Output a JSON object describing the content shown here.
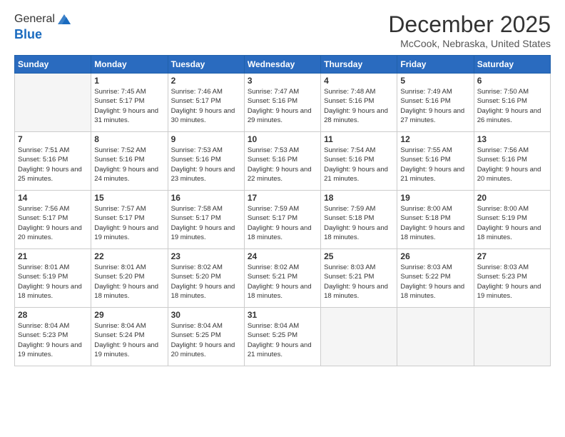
{
  "logo": {
    "general": "General",
    "blue": "Blue"
  },
  "header": {
    "month": "December 2025",
    "location": "McCook, Nebraska, United States"
  },
  "weekdays": [
    "Sunday",
    "Monday",
    "Tuesday",
    "Wednesday",
    "Thursday",
    "Friday",
    "Saturday"
  ],
  "weeks": [
    [
      {
        "day": "",
        "empty": true
      },
      {
        "day": "1",
        "sunrise": "Sunrise: 7:45 AM",
        "sunset": "Sunset: 5:17 PM",
        "daylight": "Daylight: 9 hours and 31 minutes."
      },
      {
        "day": "2",
        "sunrise": "Sunrise: 7:46 AM",
        "sunset": "Sunset: 5:17 PM",
        "daylight": "Daylight: 9 hours and 30 minutes."
      },
      {
        "day": "3",
        "sunrise": "Sunrise: 7:47 AM",
        "sunset": "Sunset: 5:16 PM",
        "daylight": "Daylight: 9 hours and 29 minutes."
      },
      {
        "day": "4",
        "sunrise": "Sunrise: 7:48 AM",
        "sunset": "Sunset: 5:16 PM",
        "daylight": "Daylight: 9 hours and 28 minutes."
      },
      {
        "day": "5",
        "sunrise": "Sunrise: 7:49 AM",
        "sunset": "Sunset: 5:16 PM",
        "daylight": "Daylight: 9 hours and 27 minutes."
      },
      {
        "day": "6",
        "sunrise": "Sunrise: 7:50 AM",
        "sunset": "Sunset: 5:16 PM",
        "daylight": "Daylight: 9 hours and 26 minutes."
      }
    ],
    [
      {
        "day": "7",
        "sunrise": "Sunrise: 7:51 AM",
        "sunset": "Sunset: 5:16 PM",
        "daylight": "Daylight: 9 hours and 25 minutes."
      },
      {
        "day": "8",
        "sunrise": "Sunrise: 7:52 AM",
        "sunset": "Sunset: 5:16 PM",
        "daylight": "Daylight: 9 hours and 24 minutes."
      },
      {
        "day": "9",
        "sunrise": "Sunrise: 7:53 AM",
        "sunset": "Sunset: 5:16 PM",
        "daylight": "Daylight: 9 hours and 23 minutes."
      },
      {
        "day": "10",
        "sunrise": "Sunrise: 7:53 AM",
        "sunset": "Sunset: 5:16 PM",
        "daylight": "Daylight: 9 hours and 22 minutes."
      },
      {
        "day": "11",
        "sunrise": "Sunrise: 7:54 AM",
        "sunset": "Sunset: 5:16 PM",
        "daylight": "Daylight: 9 hours and 21 minutes."
      },
      {
        "day": "12",
        "sunrise": "Sunrise: 7:55 AM",
        "sunset": "Sunset: 5:16 PM",
        "daylight": "Daylight: 9 hours and 21 minutes."
      },
      {
        "day": "13",
        "sunrise": "Sunrise: 7:56 AM",
        "sunset": "Sunset: 5:16 PM",
        "daylight": "Daylight: 9 hours and 20 minutes."
      }
    ],
    [
      {
        "day": "14",
        "sunrise": "Sunrise: 7:56 AM",
        "sunset": "Sunset: 5:17 PM",
        "daylight": "Daylight: 9 hours and 20 minutes."
      },
      {
        "day": "15",
        "sunrise": "Sunrise: 7:57 AM",
        "sunset": "Sunset: 5:17 PM",
        "daylight": "Daylight: 9 hours and 19 minutes."
      },
      {
        "day": "16",
        "sunrise": "Sunrise: 7:58 AM",
        "sunset": "Sunset: 5:17 PM",
        "daylight": "Daylight: 9 hours and 19 minutes."
      },
      {
        "day": "17",
        "sunrise": "Sunrise: 7:59 AM",
        "sunset": "Sunset: 5:17 PM",
        "daylight": "Daylight: 9 hours and 18 minutes."
      },
      {
        "day": "18",
        "sunrise": "Sunrise: 7:59 AM",
        "sunset": "Sunset: 5:18 PM",
        "daylight": "Daylight: 9 hours and 18 minutes."
      },
      {
        "day": "19",
        "sunrise": "Sunrise: 8:00 AM",
        "sunset": "Sunset: 5:18 PM",
        "daylight": "Daylight: 9 hours and 18 minutes."
      },
      {
        "day": "20",
        "sunrise": "Sunrise: 8:00 AM",
        "sunset": "Sunset: 5:19 PM",
        "daylight": "Daylight: 9 hours and 18 minutes."
      }
    ],
    [
      {
        "day": "21",
        "sunrise": "Sunrise: 8:01 AM",
        "sunset": "Sunset: 5:19 PM",
        "daylight": "Daylight: 9 hours and 18 minutes."
      },
      {
        "day": "22",
        "sunrise": "Sunrise: 8:01 AM",
        "sunset": "Sunset: 5:20 PM",
        "daylight": "Daylight: 9 hours and 18 minutes."
      },
      {
        "day": "23",
        "sunrise": "Sunrise: 8:02 AM",
        "sunset": "Sunset: 5:20 PM",
        "daylight": "Daylight: 9 hours and 18 minutes."
      },
      {
        "day": "24",
        "sunrise": "Sunrise: 8:02 AM",
        "sunset": "Sunset: 5:21 PM",
        "daylight": "Daylight: 9 hours and 18 minutes."
      },
      {
        "day": "25",
        "sunrise": "Sunrise: 8:03 AM",
        "sunset": "Sunset: 5:21 PM",
        "daylight": "Daylight: 9 hours and 18 minutes."
      },
      {
        "day": "26",
        "sunrise": "Sunrise: 8:03 AM",
        "sunset": "Sunset: 5:22 PM",
        "daylight": "Daylight: 9 hours and 18 minutes."
      },
      {
        "day": "27",
        "sunrise": "Sunrise: 8:03 AM",
        "sunset": "Sunset: 5:23 PM",
        "daylight": "Daylight: 9 hours and 19 minutes."
      }
    ],
    [
      {
        "day": "28",
        "sunrise": "Sunrise: 8:04 AM",
        "sunset": "Sunset: 5:23 PM",
        "daylight": "Daylight: 9 hours and 19 minutes."
      },
      {
        "day": "29",
        "sunrise": "Sunrise: 8:04 AM",
        "sunset": "Sunset: 5:24 PM",
        "daylight": "Daylight: 9 hours and 19 minutes."
      },
      {
        "day": "30",
        "sunrise": "Sunrise: 8:04 AM",
        "sunset": "Sunset: 5:25 PM",
        "daylight": "Daylight: 9 hours and 20 minutes."
      },
      {
        "day": "31",
        "sunrise": "Sunrise: 8:04 AM",
        "sunset": "Sunset: 5:25 PM",
        "daylight": "Daylight: 9 hours and 21 minutes."
      },
      {
        "day": "",
        "empty": true
      },
      {
        "day": "",
        "empty": true
      },
      {
        "day": "",
        "empty": true
      }
    ]
  ]
}
